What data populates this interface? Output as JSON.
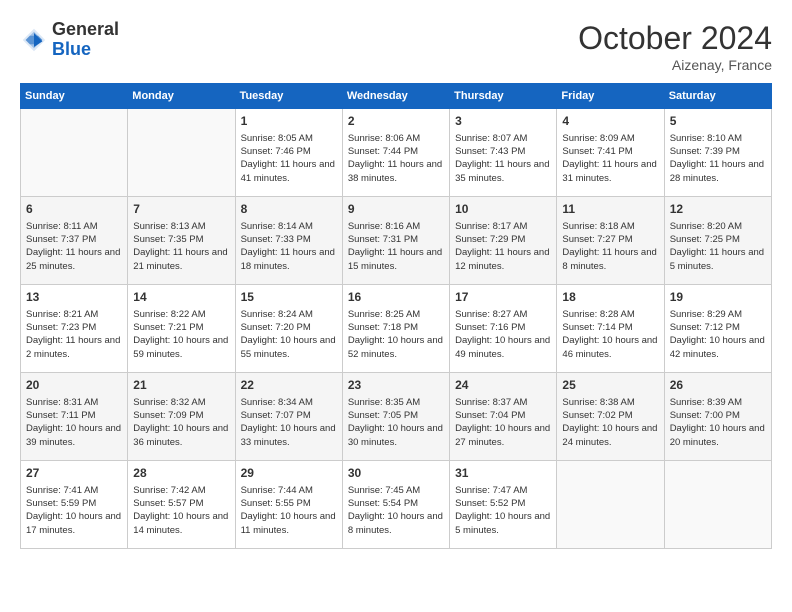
{
  "header": {
    "logo_general": "General",
    "logo_blue": "Blue",
    "month_title": "October 2024",
    "subtitle": "Aizenay, France"
  },
  "days_of_week": [
    "Sunday",
    "Monday",
    "Tuesday",
    "Wednesday",
    "Thursday",
    "Friday",
    "Saturday"
  ],
  "weeks": [
    [
      {
        "day": "",
        "sunrise": "",
        "sunset": "",
        "daylight": ""
      },
      {
        "day": "",
        "sunrise": "",
        "sunset": "",
        "daylight": ""
      },
      {
        "day": "1",
        "sunrise": "Sunrise: 8:05 AM",
        "sunset": "Sunset: 7:46 PM",
        "daylight": "Daylight: 11 hours and 41 minutes."
      },
      {
        "day": "2",
        "sunrise": "Sunrise: 8:06 AM",
        "sunset": "Sunset: 7:44 PM",
        "daylight": "Daylight: 11 hours and 38 minutes."
      },
      {
        "day": "3",
        "sunrise": "Sunrise: 8:07 AM",
        "sunset": "Sunset: 7:43 PM",
        "daylight": "Daylight: 11 hours and 35 minutes."
      },
      {
        "day": "4",
        "sunrise": "Sunrise: 8:09 AM",
        "sunset": "Sunset: 7:41 PM",
        "daylight": "Daylight: 11 hours and 31 minutes."
      },
      {
        "day": "5",
        "sunrise": "Sunrise: 8:10 AM",
        "sunset": "Sunset: 7:39 PM",
        "daylight": "Daylight: 11 hours and 28 minutes."
      }
    ],
    [
      {
        "day": "6",
        "sunrise": "Sunrise: 8:11 AM",
        "sunset": "Sunset: 7:37 PM",
        "daylight": "Daylight: 11 hours and 25 minutes."
      },
      {
        "day": "7",
        "sunrise": "Sunrise: 8:13 AM",
        "sunset": "Sunset: 7:35 PM",
        "daylight": "Daylight: 11 hours and 21 minutes."
      },
      {
        "day": "8",
        "sunrise": "Sunrise: 8:14 AM",
        "sunset": "Sunset: 7:33 PM",
        "daylight": "Daylight: 11 hours and 18 minutes."
      },
      {
        "day": "9",
        "sunrise": "Sunrise: 8:16 AM",
        "sunset": "Sunset: 7:31 PM",
        "daylight": "Daylight: 11 hours and 15 minutes."
      },
      {
        "day": "10",
        "sunrise": "Sunrise: 8:17 AM",
        "sunset": "Sunset: 7:29 PM",
        "daylight": "Daylight: 11 hours and 12 minutes."
      },
      {
        "day": "11",
        "sunrise": "Sunrise: 8:18 AM",
        "sunset": "Sunset: 7:27 PM",
        "daylight": "Daylight: 11 hours and 8 minutes."
      },
      {
        "day": "12",
        "sunrise": "Sunrise: 8:20 AM",
        "sunset": "Sunset: 7:25 PM",
        "daylight": "Daylight: 11 hours and 5 minutes."
      }
    ],
    [
      {
        "day": "13",
        "sunrise": "Sunrise: 8:21 AM",
        "sunset": "Sunset: 7:23 PM",
        "daylight": "Daylight: 11 hours and 2 minutes."
      },
      {
        "day": "14",
        "sunrise": "Sunrise: 8:22 AM",
        "sunset": "Sunset: 7:21 PM",
        "daylight": "Daylight: 10 hours and 59 minutes."
      },
      {
        "day": "15",
        "sunrise": "Sunrise: 8:24 AM",
        "sunset": "Sunset: 7:20 PM",
        "daylight": "Daylight: 10 hours and 55 minutes."
      },
      {
        "day": "16",
        "sunrise": "Sunrise: 8:25 AM",
        "sunset": "Sunset: 7:18 PM",
        "daylight": "Daylight: 10 hours and 52 minutes."
      },
      {
        "day": "17",
        "sunrise": "Sunrise: 8:27 AM",
        "sunset": "Sunset: 7:16 PM",
        "daylight": "Daylight: 10 hours and 49 minutes."
      },
      {
        "day": "18",
        "sunrise": "Sunrise: 8:28 AM",
        "sunset": "Sunset: 7:14 PM",
        "daylight": "Daylight: 10 hours and 46 minutes."
      },
      {
        "day": "19",
        "sunrise": "Sunrise: 8:29 AM",
        "sunset": "Sunset: 7:12 PM",
        "daylight": "Daylight: 10 hours and 42 minutes."
      }
    ],
    [
      {
        "day": "20",
        "sunrise": "Sunrise: 8:31 AM",
        "sunset": "Sunset: 7:11 PM",
        "daylight": "Daylight: 10 hours and 39 minutes."
      },
      {
        "day": "21",
        "sunrise": "Sunrise: 8:32 AM",
        "sunset": "Sunset: 7:09 PM",
        "daylight": "Daylight: 10 hours and 36 minutes."
      },
      {
        "day": "22",
        "sunrise": "Sunrise: 8:34 AM",
        "sunset": "Sunset: 7:07 PM",
        "daylight": "Daylight: 10 hours and 33 minutes."
      },
      {
        "day": "23",
        "sunrise": "Sunrise: 8:35 AM",
        "sunset": "Sunset: 7:05 PM",
        "daylight": "Daylight: 10 hours and 30 minutes."
      },
      {
        "day": "24",
        "sunrise": "Sunrise: 8:37 AM",
        "sunset": "Sunset: 7:04 PM",
        "daylight": "Daylight: 10 hours and 27 minutes."
      },
      {
        "day": "25",
        "sunrise": "Sunrise: 8:38 AM",
        "sunset": "Sunset: 7:02 PM",
        "daylight": "Daylight: 10 hours and 24 minutes."
      },
      {
        "day": "26",
        "sunrise": "Sunrise: 8:39 AM",
        "sunset": "Sunset: 7:00 PM",
        "daylight": "Daylight: 10 hours and 20 minutes."
      }
    ],
    [
      {
        "day": "27",
        "sunrise": "Sunrise: 7:41 AM",
        "sunset": "Sunset: 5:59 PM",
        "daylight": "Daylight: 10 hours and 17 minutes."
      },
      {
        "day": "28",
        "sunrise": "Sunrise: 7:42 AM",
        "sunset": "Sunset: 5:57 PM",
        "daylight": "Daylight: 10 hours and 14 minutes."
      },
      {
        "day": "29",
        "sunrise": "Sunrise: 7:44 AM",
        "sunset": "Sunset: 5:55 PM",
        "daylight": "Daylight: 10 hours and 11 minutes."
      },
      {
        "day": "30",
        "sunrise": "Sunrise: 7:45 AM",
        "sunset": "Sunset: 5:54 PM",
        "daylight": "Daylight: 10 hours and 8 minutes."
      },
      {
        "day": "31",
        "sunrise": "Sunrise: 7:47 AM",
        "sunset": "Sunset: 5:52 PM",
        "daylight": "Daylight: 10 hours and 5 minutes."
      },
      {
        "day": "",
        "sunrise": "",
        "sunset": "",
        "daylight": ""
      },
      {
        "day": "",
        "sunrise": "",
        "sunset": "",
        "daylight": ""
      }
    ]
  ]
}
